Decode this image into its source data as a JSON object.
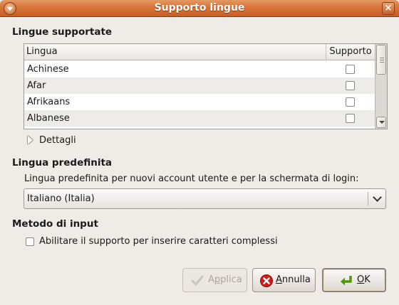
{
  "window": {
    "title": "Supporto lingue",
    "close_symbol": "×",
    "icons": [
      "window-menu-icon",
      "close-icon"
    ]
  },
  "supported_languages": {
    "title": "Lingue supportate",
    "columns": {
      "language": "Lingua",
      "support": "Supporto"
    },
    "rows": [
      {
        "name": "Achinese",
        "supported": false
      },
      {
        "name": "Afar",
        "supported": false
      },
      {
        "name": "Afrikaans",
        "supported": false
      },
      {
        "name": "Albanese",
        "supported": false
      }
    ],
    "details_label": "Dettagli"
  },
  "default_language": {
    "title": "Lingua predefinita",
    "description": "Lingua predefinita per nuovi account utente e per la schermata di login:",
    "selected": "Italiano (Italia)"
  },
  "input_method": {
    "title": "Metodo di input",
    "checkbox_label": "Abilitare il supporto per inserire caratteri complessi",
    "checked": false
  },
  "buttons": {
    "apply": {
      "prefix": "A",
      "mnemonic": "p",
      "suffix": "plica",
      "enabled": false
    },
    "cancel": {
      "prefix": "",
      "mnemonic": "A",
      "suffix": "nnulla"
    },
    "ok": {
      "prefix": "",
      "mnemonic": "O",
      "suffix": "K"
    }
  },
  "colors": {
    "titlebar": "#d8733a",
    "window_bg": "#efebe7",
    "row_alt": "#edece9",
    "cancel_icon": "#cc1d1d",
    "ok_icon": "#4e9a06"
  }
}
